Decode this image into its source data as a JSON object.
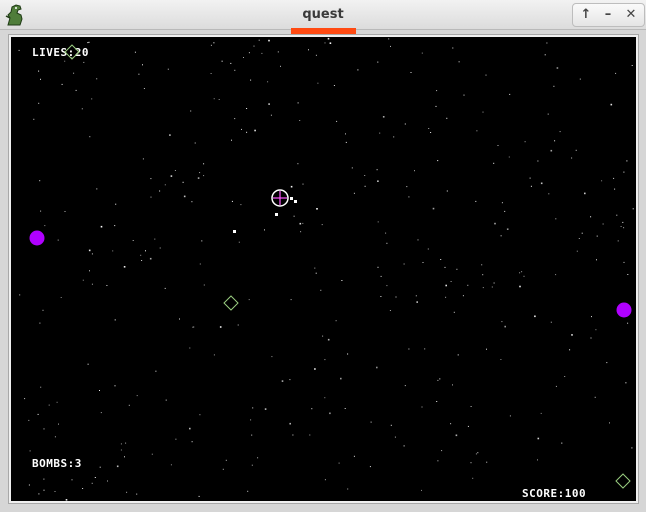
{
  "window": {
    "title": "quest",
    "app_icon": "dinosaur-icon",
    "buttons": [
      {
        "icon": "maximize-icon",
        "glyph": "↑"
      },
      {
        "icon": "minimize-icon",
        "glyph": "–"
      },
      {
        "icon": "close-icon",
        "glyph": "✕"
      }
    ],
    "accent_color": "#ff4a12"
  },
  "hud": {
    "lives_label": "LIVES:20",
    "bombs_label": "BOMBS:3",
    "score_label": "SCORE:100"
  },
  "game": {
    "background_color": "#000000",
    "player": {
      "icon": "crosshair-ship-icon",
      "color": "#ff55ff"
    },
    "enemies": [
      {
        "type": "magenta-orb",
        "color": "#b000ff"
      },
      {
        "type": "magenta-orb",
        "color": "#b000ff"
      }
    ],
    "pickups": [
      {
        "type": "green-diamond",
        "color": "#9acd80"
      },
      {
        "type": "green-diamond",
        "color": "#9acd80"
      },
      {
        "type": "green-diamond",
        "color": "#9acd80"
      }
    ]
  }
}
